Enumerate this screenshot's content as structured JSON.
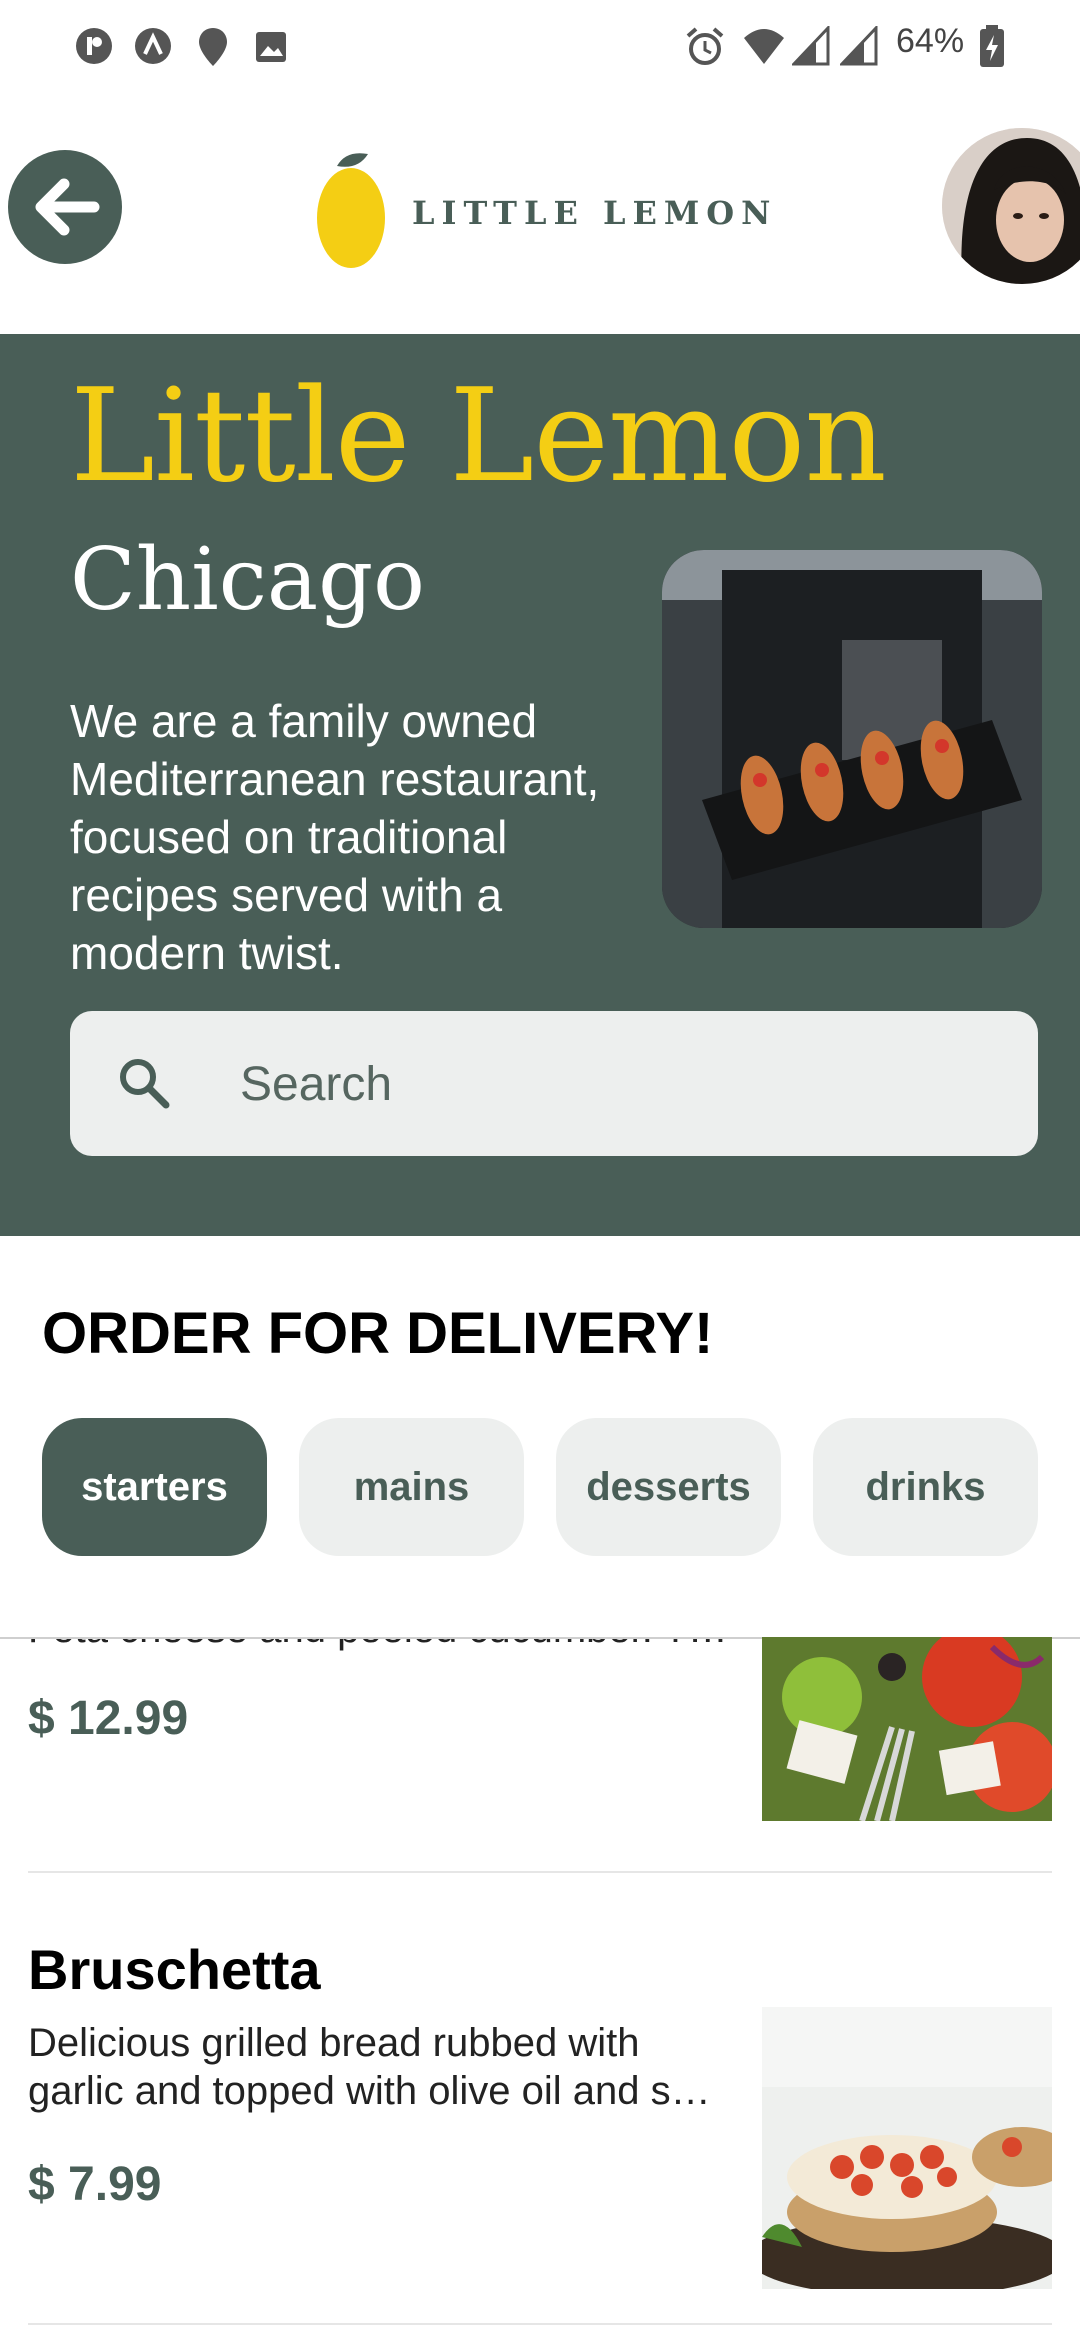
{
  "status_bar": {
    "battery": "64%",
    "left_icons": [
      "p-badge-icon",
      "a-badge-icon",
      "location-pin-icon",
      "image-icon"
    ],
    "right_icons": [
      "alarm-icon",
      "wifi-icon",
      "signal-icon",
      "signal-icon",
      "battery-charging-icon"
    ]
  },
  "header": {
    "back_icon": "arrow-left-icon",
    "logo_text": "LITTLE LEMON"
  },
  "hero": {
    "title": "Little Lemon",
    "city": "Chicago",
    "description": "We are a family owned Mediterranean restaurant, focused on traditional recipes served with a modern twist.",
    "search": {
      "placeholder": "Search",
      "value": ""
    }
  },
  "delivery": {
    "title": "ORDER FOR DELIVERY!",
    "categories": [
      {
        "label": "starters",
        "active": true
      },
      {
        "label": "mains",
        "active": false
      },
      {
        "label": "desserts",
        "active": false
      },
      {
        "label": "drinks",
        "active": false
      }
    ]
  },
  "menu": {
    "items": [
      {
        "name": "",
        "description": "Feta cheese and peeled cucumber. T…",
        "price": "$ 12.99"
      },
      {
        "name": "Bruschetta",
        "description": "Delicious grilled bread rubbed with garlic and topped with olive oil and s…",
        "price": "$ 7.99"
      }
    ]
  },
  "colors": {
    "primary": "#495e57",
    "accent": "#f4ce14",
    "chip_bg": "#edefee",
    "background": "#ffffff"
  }
}
